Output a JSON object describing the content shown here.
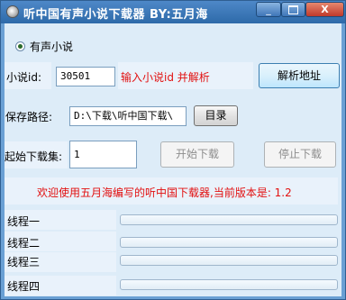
{
  "window": {
    "title": "听中国有声小说下载器  BY:五月海",
    "min_label": "_",
    "close_label": "X"
  },
  "mode": {
    "radio_label": "有声小说",
    "selected": true
  },
  "novel_id": {
    "label": "小说id:",
    "value": "30501",
    "hint": "输入小说id 并解析",
    "parse_button": "解析地址"
  },
  "save_path": {
    "label": "保存路径:",
    "value": "D:\\下载\\听中国下载\\",
    "browse_button": "目录"
  },
  "download": {
    "label": "起始下载集:",
    "value": "1",
    "start_button": "开始下载",
    "stop_button": "停止下载"
  },
  "welcome": "欢迎使用五月海编写的听中国下载器,当前版本是: 1.2",
  "threads": [
    {
      "label": "线程一",
      "progress": 0
    },
    {
      "label": "线程二",
      "progress": 0
    },
    {
      "label": "线程三",
      "progress": 0
    },
    {
      "label": "线程四",
      "progress": 0
    }
  ]
}
